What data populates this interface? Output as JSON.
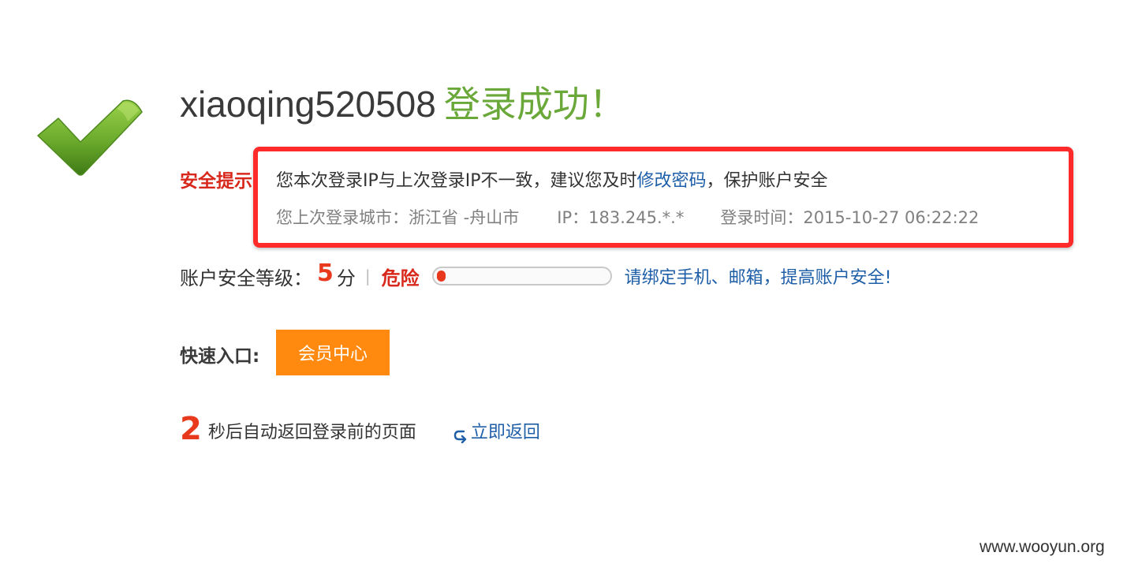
{
  "title": {
    "username": "xiaoqing520508",
    "success_text": "登录成功！"
  },
  "security_notice": {
    "label": "安全提示:",
    "line1_prefix": "您本次登录IP与上次登录IP不一致，建议您及时",
    "change_password_link": "修改密码",
    "line1_suffix": "，保护账户安全",
    "last_city": "您上次登录城市：浙江省 -舟山市",
    "last_ip": "IP：183.245.*.*",
    "last_time": "登录时间：2015-10-27 06:22:22"
  },
  "security_level": {
    "label": "账户安全等级：",
    "score": "5",
    "unit": "分",
    "separator": "|",
    "status": "危险",
    "progress_percent": 5,
    "tip": "请绑定手机、邮箱，提高账户安全!"
  },
  "quick_entry": {
    "label": "快速入口:",
    "member_center_button": "会员中心"
  },
  "redirect": {
    "seconds": "2",
    "text": "秒后自动返回登录前的页面",
    "return_now_link": "立即返回"
  },
  "watermark": "www.wooyun.org",
  "colors": {
    "success_green": "#6aa83a",
    "danger_red": "#d8281c",
    "link_blue": "#1f5fa8",
    "button_orange": "#ff8a0f",
    "highlight_red": "#ff2b2b"
  }
}
